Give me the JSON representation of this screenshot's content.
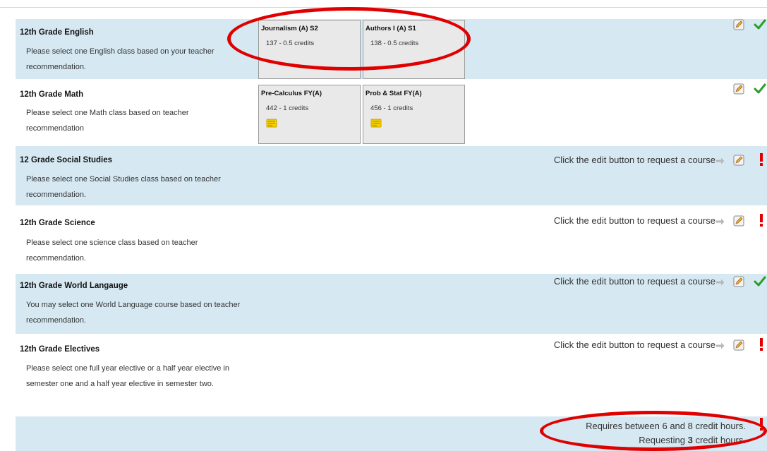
{
  "rows": [
    {
      "title": "12th Grade English",
      "description": "Please select one English class based on your teacher recommendation.",
      "status": "check",
      "courses": [
        {
          "name": "Journalism (A) S2",
          "detail": "137 - 0.5 credits",
          "has_note": false
        },
        {
          "name": "Authors I (A) S1",
          "detail": "138 - 0.5 credits",
          "has_note": false
        }
      ]
    },
    {
      "title": "12th Grade Math",
      "description": "Please select one Math class based on teacher recommendation",
      "status": "check",
      "courses": [
        {
          "name": "Pre-Calculus FY(A)",
          "detail": "442 - 1 credits",
          "has_note": true
        },
        {
          "name": "Prob & Stat FY(A)",
          "detail": "456 - 1 credits",
          "has_note": true
        }
      ]
    },
    {
      "title": "12 Grade Social Studies",
      "description": "Please select one Social Studies class based on teacher recommendation.",
      "status": "error",
      "prompt": "Click the edit button to request a course"
    },
    {
      "title": "12th Grade Science",
      "description": "Please select one science class based on teacher recommendation.",
      "status": "error",
      "prompt": "Click the edit button to request a course"
    },
    {
      "title": "12th Grade World Langauge",
      "description": "You may select one World Language course based on teacher recommendation.",
      "status": "check",
      "prompt": "Click the edit button to request a course"
    },
    {
      "title": "12th Grade Electives",
      "description": "Please select one full year elective or a half year elective in semester one and a half year elective in semester two.",
      "status": "error",
      "prompt": "Click the edit button to request a course"
    }
  ],
  "footer": {
    "requirement": "Requires between 6 and 8 credit hours.",
    "requesting_prefix": "Requesting",
    "requesting_value": "3",
    "requesting_suffix": "credit hours."
  },
  "icons": {
    "edit": "pencil-edit-icon",
    "check": "green-checkmark-icon",
    "error": "red-exclamation-icon",
    "arrow": "right-arrow-icon",
    "note": "sticky-note-icon"
  },
  "colors": {
    "row_blue": "#d6e9f3",
    "check_green": "#2a9d2a",
    "error_red": "#e00000",
    "annotation_red": "#e00000"
  }
}
